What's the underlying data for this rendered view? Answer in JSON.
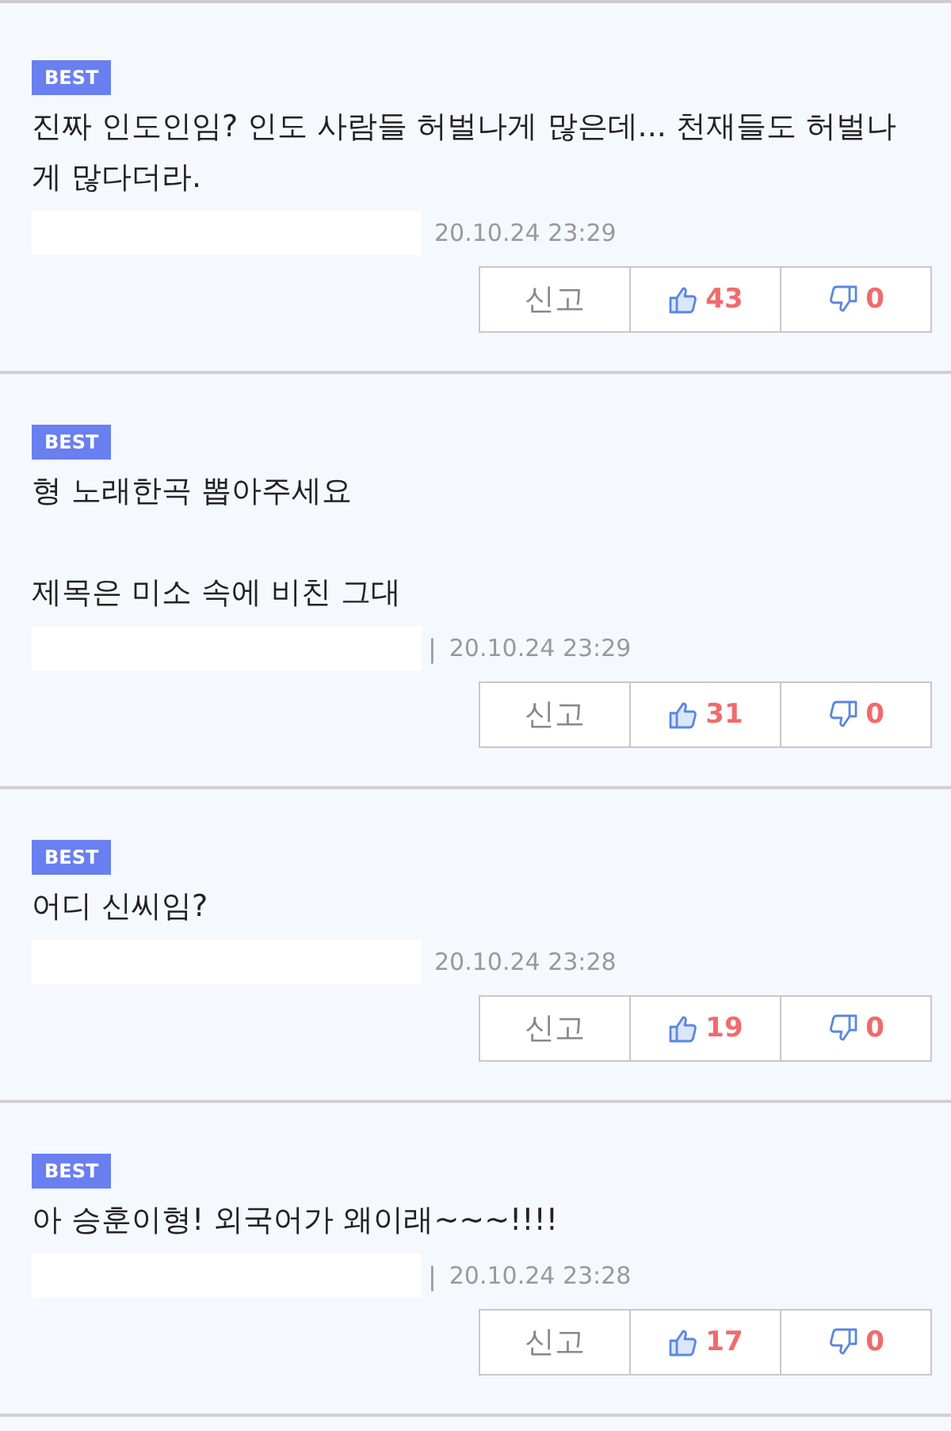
{
  "comments": [
    {
      "badge": "BEST",
      "text": "진짜 인도인임? 인도 사람들 허벌나게 많은데... 천재들도 허벌나게 많다더라.",
      "date": "20.10.24 23:29",
      "report": "신고",
      "likes": "43",
      "dislikes": "0"
    },
    {
      "badge": "BEST",
      "text": "형 노래한곡 뽑아주세요\n\n제목은 미소 속에 비친 그대",
      "separator": "|",
      "date": "20.10.24 23:29",
      "report": "신고",
      "likes": "31",
      "dislikes": "0"
    },
    {
      "badge": "BEST",
      "text": "어디 신씨임?",
      "date": "20.10.24 23:28",
      "report": "신고",
      "likes": "19",
      "dislikes": "0"
    },
    {
      "badge": "BEST",
      "text": "아 승훈이형! 외국어가 왜이래~~~!!!!",
      "separator": "|",
      "date": "20.10.24 23:28",
      "report": "신고",
      "likes": "17",
      "dislikes": "0"
    }
  ]
}
